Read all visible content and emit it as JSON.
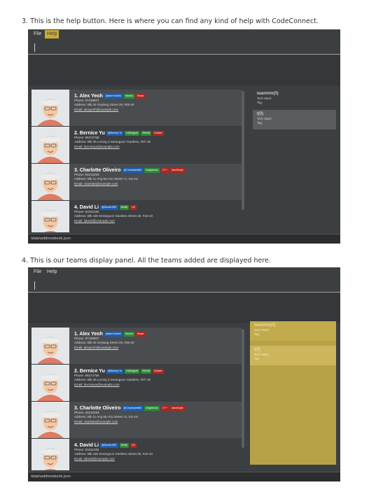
{
  "captions": {
    "help": "3. This is the help button. Here is where you can find any kind of help with CodeConnect.",
    "teams": "4. This is our teams display panel. All the teams added are displayed here."
  },
  "menu": {
    "file": "File",
    "help": "Help"
  },
  "persons": [
    {
      "name": "1. Alex Yeoh",
      "tags": [
        {
          "label": "@alexYeohhh",
          "color": "blue"
        },
        {
          "label": "friends",
          "color": "green"
        },
        {
          "label": "React",
          "color": "red"
        }
      ],
      "phone": "Phone: 87438807",
      "address": "Address: Blk 30 Geylang Street 29, #06-40",
      "email": "Email: alexyeoh@example.com"
    },
    {
      "name": "2. Bernice Yu",
      "tags": [
        {
          "label": "@Berney-Yu",
          "color": "blue"
        },
        {
          "label": "colleagues",
          "color": "green"
        },
        {
          "label": "friends",
          "color": "green"
        },
        {
          "label": "Docker",
          "color": "red"
        }
      ],
      "phone": "Phone: 99272758",
      "address": "Address: Blk 30 Lorong 3 Serangoon Gardens, #07-18",
      "email": "Email: berniceyu@example.com"
    },
    {
      "name": "3. Charlotte Oliveiro",
      "tags": [
        {
          "label": "@Charlowie666",
          "color": "blue"
        },
        {
          "label": "neighbours",
          "color": "green"
        },
        {
          "label": "C++",
          "color": "red"
        },
        {
          "label": "JavaScript",
          "color": "red"
        }
      ],
      "phone": "Phone: 93210283",
      "address": "Address: Blk 11 Ang Mo Kio Street 74, #11-04",
      "email": "Email: charlotte@example.com"
    },
    {
      "name": "4. David Li",
      "tags": [
        {
          "label": "@DavidLi987",
          "color": "blue"
        },
        {
          "label": "family",
          "color": "green"
        },
        {
          "label": "C#",
          "color": "red"
        }
      ],
      "phone": "Phone: 91031282",
      "address": "Address: Blk 436 Serangoon Gardens Street 26, #16-43",
      "email": "Email: lidavid@example.com"
    }
  ],
  "teams": [
    {
      "name": "teammm(0)",
      "tech": "Tech Stack:",
      "tag": "Tag:"
    },
    {
      "name": "t(0)",
      "tech": "Tech Stack:",
      "tag": "Tag:"
    }
  ],
  "status": "\\data\\addressbook.json",
  "colors": {
    "app_bg": "#3c3f41",
    "help_highlight": "#c9a93a",
    "team_highlight": "#b8a247"
  }
}
